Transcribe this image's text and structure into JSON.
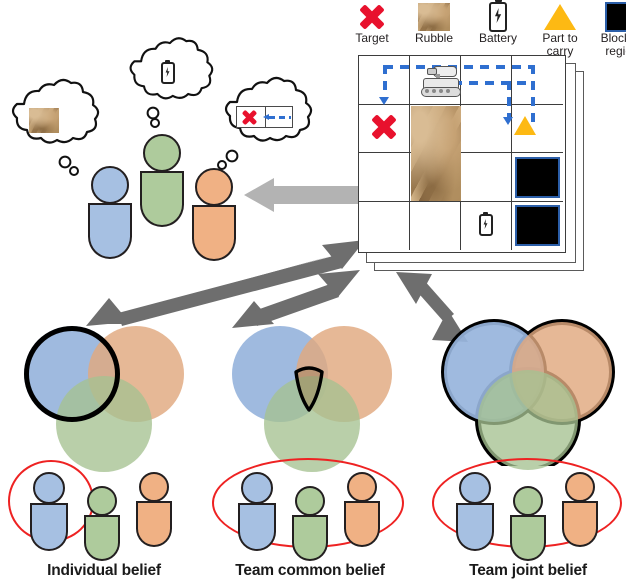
{
  "legend": {
    "items": [
      {
        "icon": "target-x-icon",
        "label": "Target"
      },
      {
        "icon": "rubble-texture-icon",
        "label": "Rubble"
      },
      {
        "icon": "battery-icon",
        "label": "Battery"
      },
      {
        "icon": "part-to-carry-triangle-icon",
        "label": "Part to\ncarry"
      },
      {
        "icon": "blocked-region-icon",
        "label": "Blocked\nregion"
      }
    ],
    "label_target": "Target",
    "label_rubble": "Rubble",
    "label_battery": "Battery",
    "label_part1": "Part to",
    "label_part2": "carry",
    "label_blocked1": "Blocked",
    "label_blocked2": "region"
  },
  "map": {
    "rows": 4,
    "cols": 4,
    "stacked_layers": 2,
    "contents": [
      {
        "row": 0,
        "col": 1,
        "icon": "robot-icon"
      },
      {
        "row": 1,
        "col": 0,
        "icon": "target-x-icon"
      },
      {
        "row": 1,
        "col": 1,
        "icon": "rubble-texture-icon"
      },
      {
        "row": 2,
        "col": 1,
        "icon": "rubble-texture-icon"
      },
      {
        "row": 1,
        "col": 3,
        "icon": "part-to-carry-triangle-icon"
      },
      {
        "row": 2,
        "col": 3,
        "icon": "blocked-region-icon"
      },
      {
        "row": 3,
        "col": 3,
        "icon": "blocked-region-icon"
      },
      {
        "row": 3,
        "col": 2,
        "icon": "battery-icon"
      }
    ],
    "path_color": "#2f6fd0"
  },
  "beliefs": {
    "bubbles": [
      {
        "owner": "blue-agent",
        "content_icon": "rubble-texture-icon"
      },
      {
        "owner": "green-agent",
        "content_icon": "battery-icon"
      },
      {
        "owner": "orange-agent",
        "content_icon": "target-path-minimap-icon"
      }
    ],
    "agents": [
      {
        "name": "blue-agent",
        "color": "#a6c0e2"
      },
      {
        "name": "green-agent",
        "color": "#aecb9c"
      },
      {
        "name": "orange-agent",
        "color": "#f0b184"
      }
    ]
  },
  "arrows": {
    "observation_arrow": "grid-to-agents-arrow",
    "individual_arrow": "grid-to-individual-belief-arrow",
    "common_arrow": "grid-to-team-common-belief-arrow",
    "joint_arrow": "grid-to-team-joint-belief-arrow",
    "color_light": "#b3b3b3",
    "color_dark": "#6e6e6e"
  },
  "venns": [
    {
      "id": "individual",
      "caption": "Individual belief",
      "highlight": "blue-circle-outline",
      "selected_agents": [
        "blue-agent"
      ],
      "circles": [
        "blue",
        "orange",
        "green"
      ]
    },
    {
      "id": "common",
      "caption": "Team common belief",
      "highlight": "triple-intersection-outline",
      "selected_agents": [
        "blue-agent",
        "green-agent",
        "orange-agent"
      ],
      "circles": [
        "blue",
        "orange",
        "green"
      ]
    },
    {
      "id": "joint",
      "caption": "Team joint belief",
      "highlight": "union-outline",
      "selected_agents": [
        "blue-agent",
        "green-agent",
        "orange-agent"
      ],
      "circles": [
        "blue",
        "orange",
        "green"
      ]
    }
  ],
  "colors": {
    "blue": "#a6c0e2",
    "orange": "#f0b184",
    "green": "#aecb9c",
    "venn_blue": "#97b4dc",
    "venn_orange": "#e0a87f",
    "venn_green": "#a5c191",
    "red": "#ee2222",
    "outline": "#231f20"
  }
}
